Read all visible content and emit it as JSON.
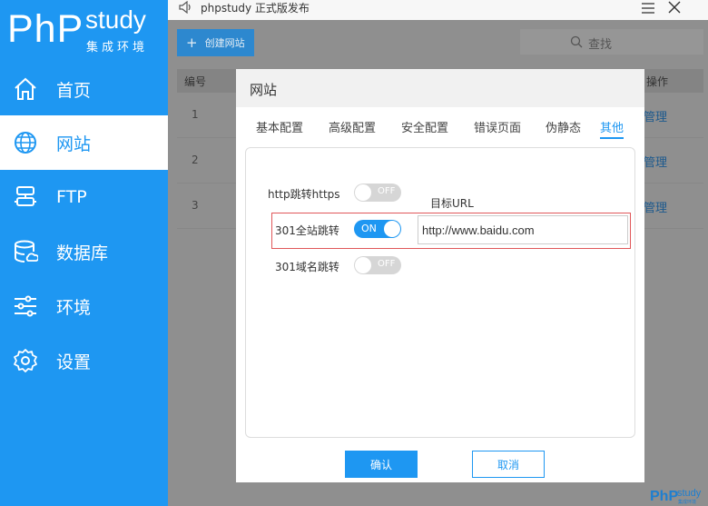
{
  "app": {
    "logo_main": "PhP",
    "logo_study": "study",
    "logo_sub": "集成环境",
    "title": "phpstudy 正式版发布"
  },
  "sidebar": {
    "items": [
      {
        "label": "首页",
        "icon": "home-icon"
      },
      {
        "label": "网站",
        "icon": "globe-icon",
        "active": true
      },
      {
        "label": "FTP",
        "icon": "server-icon"
      },
      {
        "label": "数据库",
        "icon": "database-icon"
      },
      {
        "label": "环境",
        "icon": "sliders-icon"
      },
      {
        "label": "设置",
        "icon": "gear-icon"
      }
    ]
  },
  "toolbar": {
    "create_label": "创建网站",
    "search_placeholder": "查找"
  },
  "table": {
    "col_id": "编号",
    "col_op": "操作",
    "rows": [
      {
        "id": "1",
        "op": "管理"
      },
      {
        "id": "2",
        "op": "管理"
      },
      {
        "id": "3",
        "op": "管理"
      }
    ]
  },
  "dialog": {
    "title": "网站",
    "tabs": [
      "基本配置",
      "高级配置",
      "安全配置",
      "错误页面",
      "伪静态",
      "其他"
    ],
    "active_tab": "其他",
    "options": [
      {
        "label": "http跳转https",
        "state": "OFF"
      },
      {
        "label": "301全站跳转",
        "state": "ON"
      },
      {
        "label": "301域名跳转",
        "state": "OFF"
      }
    ],
    "target_url_label": "目标URL",
    "target_url_value": "http://www.baidu.com",
    "confirm_label": "确认",
    "cancel_label": "取消"
  },
  "colors": {
    "brand": "#1e97f2",
    "highlight": "#e0575a"
  }
}
